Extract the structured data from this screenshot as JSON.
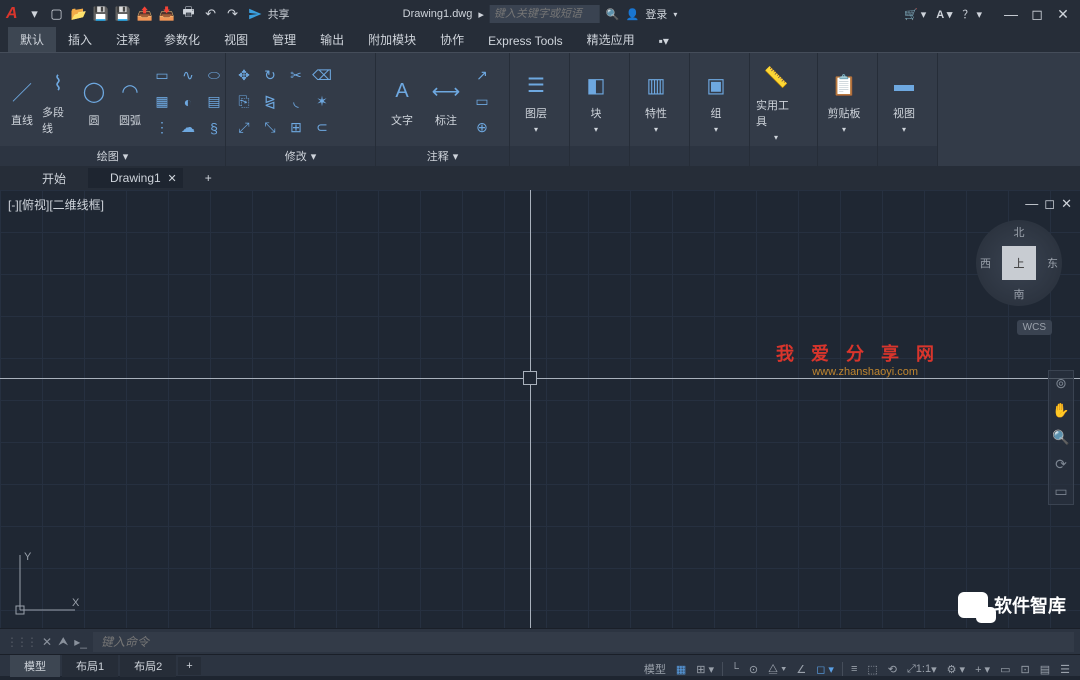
{
  "app": {
    "title": "Drawing1.dwg",
    "share": "共享",
    "login": "登录"
  },
  "search": {
    "placeholder": "键入关键字或短语"
  },
  "ribbon_tabs": [
    "默认",
    "插入",
    "注释",
    "参数化",
    "视图",
    "管理",
    "输出",
    "附加模块",
    "协作",
    "Express Tools",
    "精选应用"
  ],
  "panels": {
    "draw": {
      "title": "绘图",
      "line": "直线",
      "polyline": "多段线",
      "circle": "圆",
      "arc": "圆弧"
    },
    "modify": {
      "title": "修改"
    },
    "annotate": {
      "title": "注释",
      "text": "文字",
      "dim": "标注"
    },
    "p4": {
      "label": "图层"
    },
    "p5": {
      "label": "块"
    },
    "p6": {
      "label": "特性"
    },
    "p7": {
      "label": "组"
    },
    "p8": {
      "label": "实用工具"
    },
    "p9": {
      "label": "剪贴板"
    },
    "p10": {
      "label": "视图"
    }
  },
  "file_tabs": {
    "start": "开始",
    "active": "Drawing1"
  },
  "viewport": {
    "label": "[-][俯视][二维线框]"
  },
  "viewcube": {
    "top": "上",
    "n": "北",
    "s": "南",
    "e": "东",
    "w": "西",
    "wcs": "WCS"
  },
  "watermark": {
    "line1": "我 爱 分 享 网",
    "line2": "www.zhanshaoyi.com"
  },
  "brand": "软件智库",
  "cmd": {
    "placeholder": "键入命令"
  },
  "layout_tabs": {
    "model": "模型",
    "l1": "布局1",
    "l2": "布局2"
  },
  "status": {
    "model": "模型",
    "scale": "1:1"
  }
}
